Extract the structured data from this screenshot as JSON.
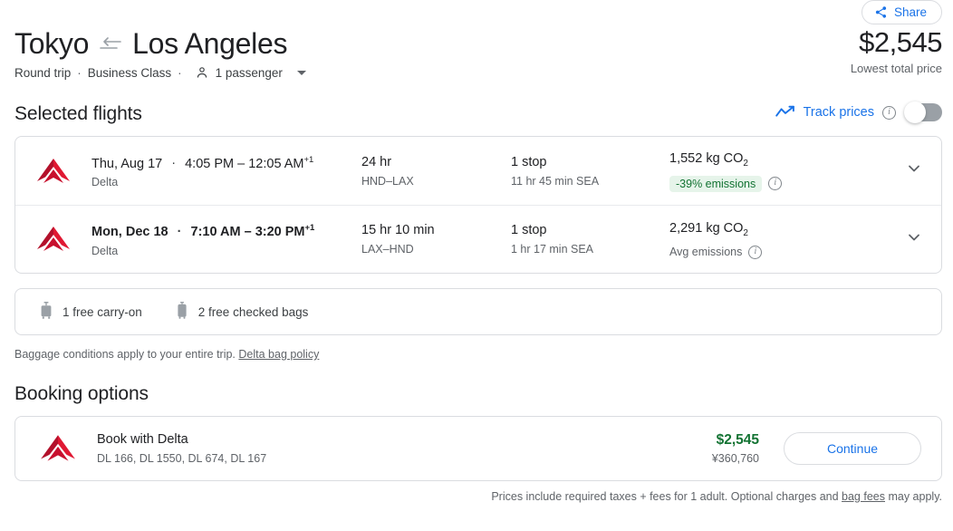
{
  "share": {
    "label": "Share",
    "icon": "share-icon"
  },
  "header": {
    "origin": "Tokyo",
    "destination": "Los Angeles",
    "swap_icon": "swap-arrows-icon",
    "trip_type": "Round trip",
    "cabin_class": "Business Class",
    "passengers": "1 passenger",
    "separator": "·",
    "total_price": "$2,545",
    "price_caption": "Lowest total price"
  },
  "selected_flights": {
    "title": "Selected flights",
    "track_prices": {
      "label": "Track prices",
      "icon": "trending-up-icon",
      "info_icon": "info-icon",
      "toggle_state": "off"
    },
    "rows": [
      {
        "airline_logo": "delta-logo",
        "date": "Thu, Aug 17",
        "times": "4:05 PM – 12:05 AM",
        "day_offset": "+1",
        "airline": "Delta",
        "duration": "24 hr",
        "route": "HND–LAX",
        "stops": "1 stop",
        "layover": "11 hr 45 min SEA",
        "co2": "1,552 kg CO",
        "co2_sub": "2",
        "emissions_badge": "-39% emissions",
        "expand_icon": "chevron-down-icon"
      },
      {
        "airline_logo": "delta-logo",
        "date": "Mon, Dec 18",
        "times": "7:10 AM – 3:20 PM",
        "day_offset": "+1",
        "airline": "Delta",
        "duration": "15 hr 10 min",
        "route": "LAX–HND",
        "stops": "1 stop",
        "layover": "1 hr 17 min SEA",
        "co2": "2,291 kg CO",
        "co2_sub": "2",
        "emissions_text": "Avg emissions",
        "expand_icon": "chevron-down-icon"
      }
    ]
  },
  "baggage": {
    "carry_on": "1 free carry-on",
    "checked": "2 free checked bags",
    "carry_on_icon": "carry-on-bag-icon",
    "checked_icon": "checked-bag-icon",
    "note_text": "Baggage conditions apply to your entire trip. ",
    "note_link": "Delta bag policy"
  },
  "booking_options": {
    "title": "Booking options",
    "option": {
      "airline_logo": "delta-logo",
      "name": "Book with Delta",
      "flight_numbers": "DL 166, DL 1550, DL 674, DL 167",
      "price": "$2,545",
      "price_alt": "¥360,760",
      "button_label": "Continue"
    }
  },
  "footer": {
    "text_before": "Prices include required taxes + fees for 1 adult. Optional charges and ",
    "link": "bag fees",
    "text_after": " may apply."
  },
  "colors": {
    "accent_blue": "#1a73e8",
    "price_green": "#137333",
    "badge_bg": "#e6f4ea",
    "delta_red": "#c8102e",
    "border": "#dadce0"
  }
}
